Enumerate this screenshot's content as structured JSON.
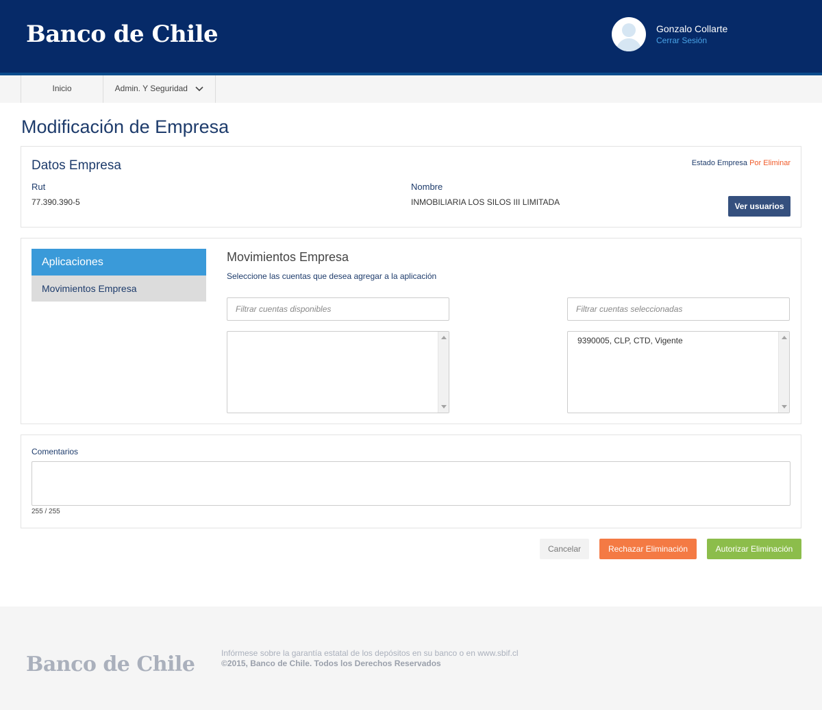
{
  "header": {
    "logo": "Banco de Chile",
    "user_name": "Gonzalo Collarte",
    "logout": "Cerrar Sesión"
  },
  "nav": {
    "items": [
      {
        "label": "Inicio"
      },
      {
        "label": "Admin. Y Seguridad"
      }
    ]
  },
  "page": {
    "title": "Modificación de Empresa"
  },
  "datos": {
    "title": "Datos Empresa",
    "estado_label": "Estado Empresa",
    "estado_value": "Por Eliminar",
    "rut_label": "Rut",
    "rut_value": "77.390.390-5",
    "nombre_label": "Nombre",
    "nombre_value": "INMOBILIARIA LOS SILOS III LIMITADA",
    "ver_usuarios": "Ver usuarios"
  },
  "aplicaciones": {
    "header": "Aplicaciones",
    "items": [
      {
        "label": "Movimientos Empresa"
      }
    ]
  },
  "movimientos": {
    "title": "Movimientos Empresa",
    "subtitle": "Seleccione las cuentas que desea agregar a la aplicación",
    "filter_available_placeholder": "Filtrar cuentas disponibles",
    "filter_selected_placeholder": "Filtrar cuentas seleccionadas",
    "available_accounts": [],
    "selected_accounts": [
      "9390005, CLP, CTD, Vigente"
    ]
  },
  "comentarios": {
    "label": "Comentarios",
    "counter": "255 / 255"
  },
  "actions": {
    "cancel": "Cancelar",
    "reject": "Rechazar Eliminación",
    "authorize": "Autorizar Eliminación"
  },
  "footer": {
    "logo": "Banco de Chile",
    "line1": "Infórmese sobre la garantía estatal de los depósitos en su banco o en www.sbif.cl",
    "line2": "©2015, Banco de Chile. Todos los Derechos Reservados"
  },
  "colors": {
    "header_bg": "#062a68",
    "accent_blue": "#3a9ad9",
    "reject_orange": "#f47a44",
    "authorize_green": "#8cbd4b",
    "status_red": "#f05a28"
  }
}
